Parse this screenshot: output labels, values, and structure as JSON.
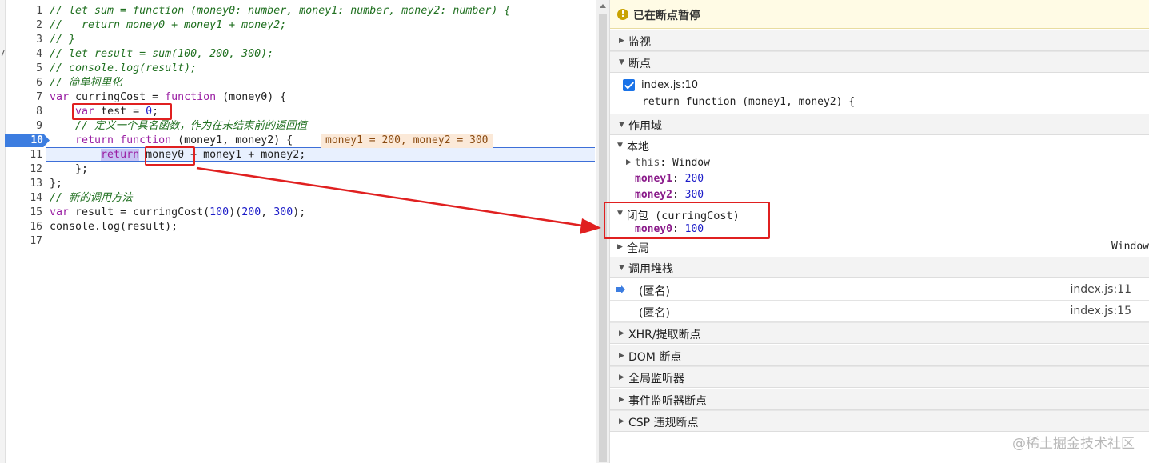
{
  "editor": {
    "gutter_mark": "7",
    "line_numbers": [
      "1",
      "2",
      "3",
      "4",
      "5",
      "6",
      "7",
      "8",
      "9",
      "10",
      "11",
      "12",
      "13",
      "14",
      "15",
      "16",
      "17"
    ],
    "breakpoint_line": "10",
    "lines": {
      "l1": "// let sum = function (money0: number, money1: number, money2: number) {",
      "l2": "//   return money0 + money1 + money2;",
      "l3": "// }",
      "l4": "// let result = sum(100, 200, 300);",
      "l5": "// console.log(result);",
      "l6": "// 简单柯里化",
      "l7_kw": "var",
      "l7_name": " curringCost = ",
      "l7_fn": "function",
      "l7_rest": " (money0) {",
      "l8_indent": "    ",
      "l8_kw": "var",
      "l8_mid": " test = ",
      "l8_num": "0",
      "l8_end": ";",
      "l9": "    // 定义一个具名函数，作为在未结束前的返回值",
      "l10_indent": "    ",
      "l10_kw": "return",
      "l10_sp": " ",
      "l10_fn": "function",
      "l10_rest": " (money1, money2) {",
      "l11_indent": "        ",
      "l11_kw": "return",
      "l11_sp": " ",
      "l11_rest": "money0 + money1 + money2;",
      "l12": "    };",
      "l13": "};",
      "l14": "// 新的调用方法",
      "l15_kw": "var",
      "l15_a": " result = curringCost(",
      "l15_n1": "100",
      "l15_b": ")(",
      "l15_n2": "200",
      "l15_c": ", ",
      "l15_n3": "300",
      "l15_d": ");",
      "l16": "console.log(result);"
    },
    "inline_value": "money1 = 200, money2 = 300"
  },
  "debugger": {
    "paused_icon": "!",
    "paused_text": "已在断点暂停",
    "sections": {
      "watch": "监视",
      "breakpoints": "断点",
      "scope": "作用域",
      "callstack": "调用堆栈",
      "xhr": "XHR/提取断点",
      "dom": "DOM 断点",
      "global_listeners": "全局监听器",
      "event_listeners": "事件监听器断点",
      "csp": "CSP 违规断点"
    },
    "breakpoint_entry": {
      "file": "index.js:10",
      "code": "return function (money1, money2) {"
    },
    "scope": {
      "local_label": "本地",
      "this_key": "this",
      "this_val": ": Window",
      "money1_key": "money1",
      "money1_val": "200",
      "money2_key": "money2",
      "money2_val": "300",
      "closure_label": "闭包 (curringCost)",
      "money0_key": "money0",
      "money0_val": "100",
      "global_label": "全局",
      "global_val": "Window"
    },
    "call_stack": [
      {
        "name": "(匿名)",
        "location": "index.js:11"
      },
      {
        "name": "(匿名)",
        "location": "index.js:15"
      }
    ],
    "sep": ": "
  },
  "watermark": "@稀土掘金技术社区",
  "colors": {
    "breakpoint": "#3c7de0",
    "annotation": "#e02020",
    "paused_bg": "#fffbe5"
  }
}
